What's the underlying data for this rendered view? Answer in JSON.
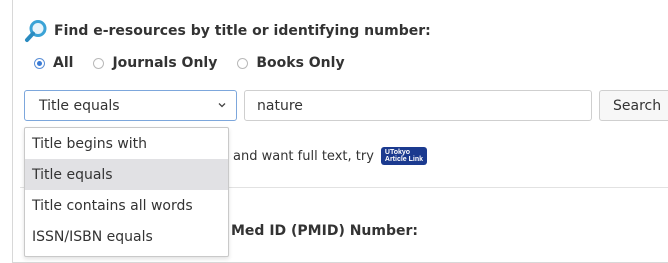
{
  "heading": "Find e-resources by title or identifying number:",
  "scope": {
    "options": [
      {
        "label": "All",
        "selected": true
      },
      {
        "label": "Journals Only",
        "selected": false
      },
      {
        "label": "Books Only",
        "selected": false
      }
    ]
  },
  "search": {
    "mode_selected": "Title equals",
    "query": "nature",
    "button_label": "Search"
  },
  "dropdown": {
    "options": [
      "Title begins with",
      "Title equals",
      "Title contains all words",
      "ISSN/ISBN equals"
    ],
    "highlighted_index": 1
  },
  "hint": {
    "text": "and want full text, try",
    "badge_line1": "UTokyo",
    "badge_line2": "Article Link"
  },
  "pmid_heading": "Med ID (PMID) Number:",
  "colors": {
    "accent": "#3a7bd5",
    "badge": "#1b3a8f"
  }
}
